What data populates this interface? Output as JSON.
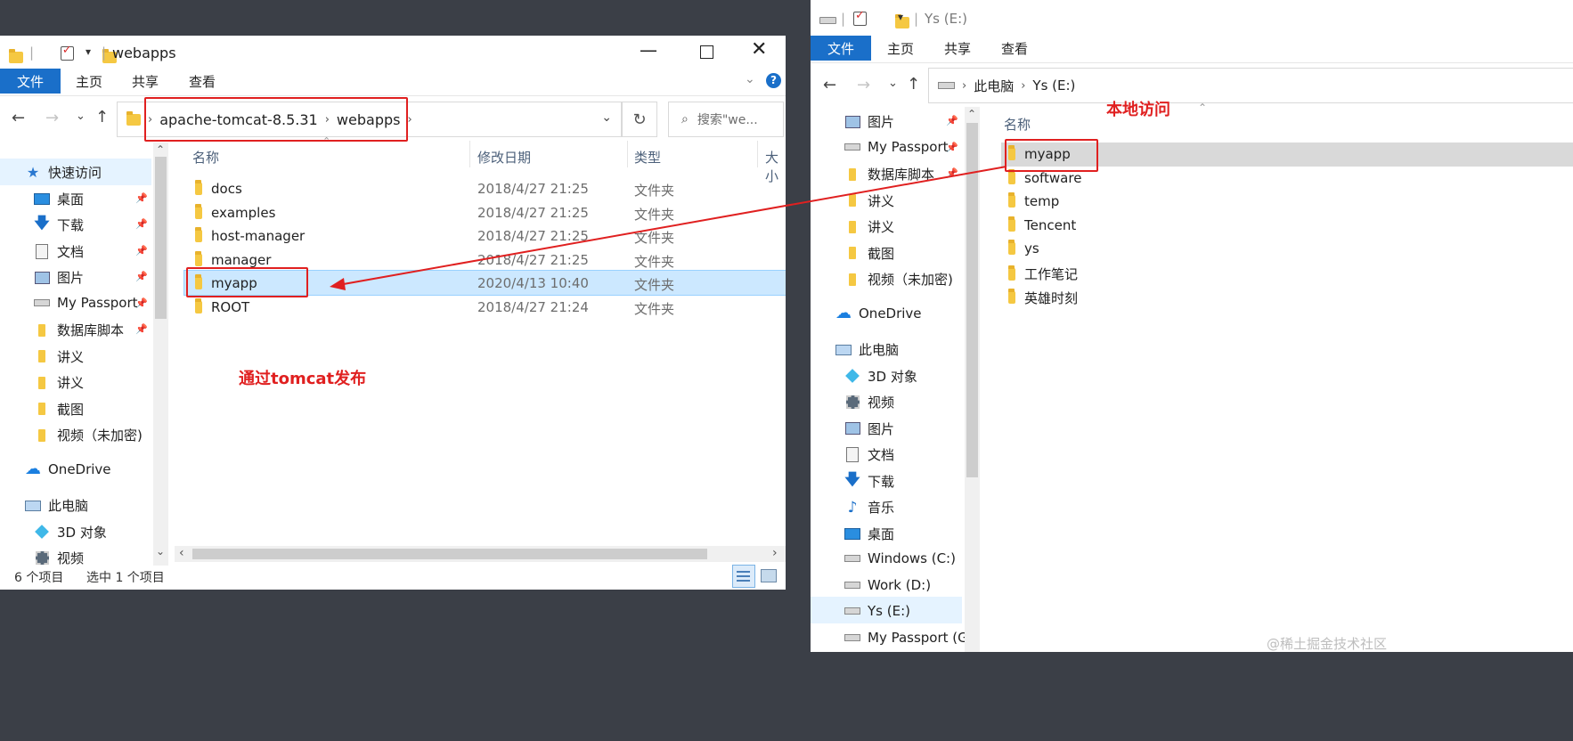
{
  "left_window": {
    "title": "webapps",
    "ribbon_tabs": {
      "file": "文件",
      "home": "主页",
      "share": "共享",
      "view": "查看"
    },
    "breadcrumb": [
      "apache-tomcat-8.5.31",
      "webapps"
    ],
    "search_placeholder": "搜索\"we...",
    "nav_items": [
      {
        "label": "快速访问",
        "icon": "star-icon"
      },
      {
        "label": "桌面",
        "icon": "desktop-icon"
      },
      {
        "label": "下载",
        "icon": "download-icon"
      },
      {
        "label": "文档",
        "icon": "document-icon"
      },
      {
        "label": "图片",
        "icon": "picture-icon"
      },
      {
        "label": "My Passport",
        "icon": "drive-icon"
      },
      {
        "label": "数据库脚本",
        "icon": "folder-icon"
      },
      {
        "label": "讲义",
        "icon": "folder-icon"
      },
      {
        "label": "讲义",
        "icon": "folder-icon"
      },
      {
        "label": "截图",
        "icon": "folder-icon"
      },
      {
        "label": "视频（未加密)",
        "icon": "folder-icon"
      },
      {
        "label": "OneDrive",
        "icon": "cloud-icon"
      },
      {
        "label": "此电脑",
        "icon": "computer-icon"
      },
      {
        "label": "3D 对象",
        "icon": "cube-icon"
      },
      {
        "label": "视频",
        "icon": "video-icon"
      }
    ],
    "columns": {
      "name": "名称",
      "modified": "修改日期",
      "type": "类型",
      "size": "大小"
    },
    "files": [
      {
        "name": "docs",
        "modified": "2018/4/27 21:25",
        "type": "文件夹"
      },
      {
        "name": "examples",
        "modified": "2018/4/27 21:25",
        "type": "文件夹"
      },
      {
        "name": "host-manager",
        "modified": "2018/4/27 21:25",
        "type": "文件夹"
      },
      {
        "name": "manager",
        "modified": "2018/4/27 21:25",
        "type": "文件夹"
      },
      {
        "name": "myapp",
        "modified": "2020/4/13 10:40",
        "type": "文件夹"
      },
      {
        "name": "ROOT",
        "modified": "2018/4/27 21:24",
        "type": "文件夹"
      }
    ],
    "status": {
      "count": "6 个项目",
      "selected": "选中 1 个项目"
    }
  },
  "right_window": {
    "title": "Ys (E:)",
    "ribbon_tabs": {
      "file": "文件",
      "home": "主页",
      "share": "共享",
      "view": "查看"
    },
    "breadcrumb": [
      "此电脑",
      "Ys (E:)"
    ],
    "nav_items": [
      {
        "label": "图片",
        "icon": "picture-icon"
      },
      {
        "label": "My Passport",
        "icon": "drive-icon"
      },
      {
        "label": "数据库脚本",
        "icon": "folder-icon"
      },
      {
        "label": "讲义",
        "icon": "folder-icon"
      },
      {
        "label": "讲义",
        "icon": "folder-icon"
      },
      {
        "label": "截图",
        "icon": "folder-icon"
      },
      {
        "label": "视频（未加密)",
        "icon": "folder-icon"
      },
      {
        "label": "OneDrive",
        "icon": "cloud-icon"
      },
      {
        "label": "此电脑",
        "icon": "computer-icon"
      },
      {
        "label": "3D 对象",
        "icon": "cube-icon"
      },
      {
        "label": "视频",
        "icon": "video-icon"
      },
      {
        "label": "图片",
        "icon": "picture-icon"
      },
      {
        "label": "文档",
        "icon": "document-icon"
      },
      {
        "label": "下载",
        "icon": "download-icon"
      },
      {
        "label": "音乐",
        "icon": "music-icon"
      },
      {
        "label": "桌面",
        "icon": "desktop-icon"
      },
      {
        "label": "Windows (C:)",
        "icon": "drive-icon"
      },
      {
        "label": "Work (D:)",
        "icon": "drive-icon"
      },
      {
        "label": "Ys (E:)",
        "icon": "drive-icon"
      },
      {
        "label": "My Passport (G",
        "icon": "drive-icon"
      }
    ],
    "column_name": "名称",
    "files": [
      "myapp",
      "software",
      "temp",
      "Tencent",
      "ys",
      "工作笔记",
      "英雄时刻"
    ]
  },
  "annotations": {
    "publish": "通过tomcat发布",
    "local": "本地访问"
  },
  "watermark": "@稀土掘金技术社区",
  "colors": {
    "accent": "#1a6fc9",
    "annotation": "#e02020",
    "selection": "#cce8ff",
    "folder": "#f5c842"
  }
}
